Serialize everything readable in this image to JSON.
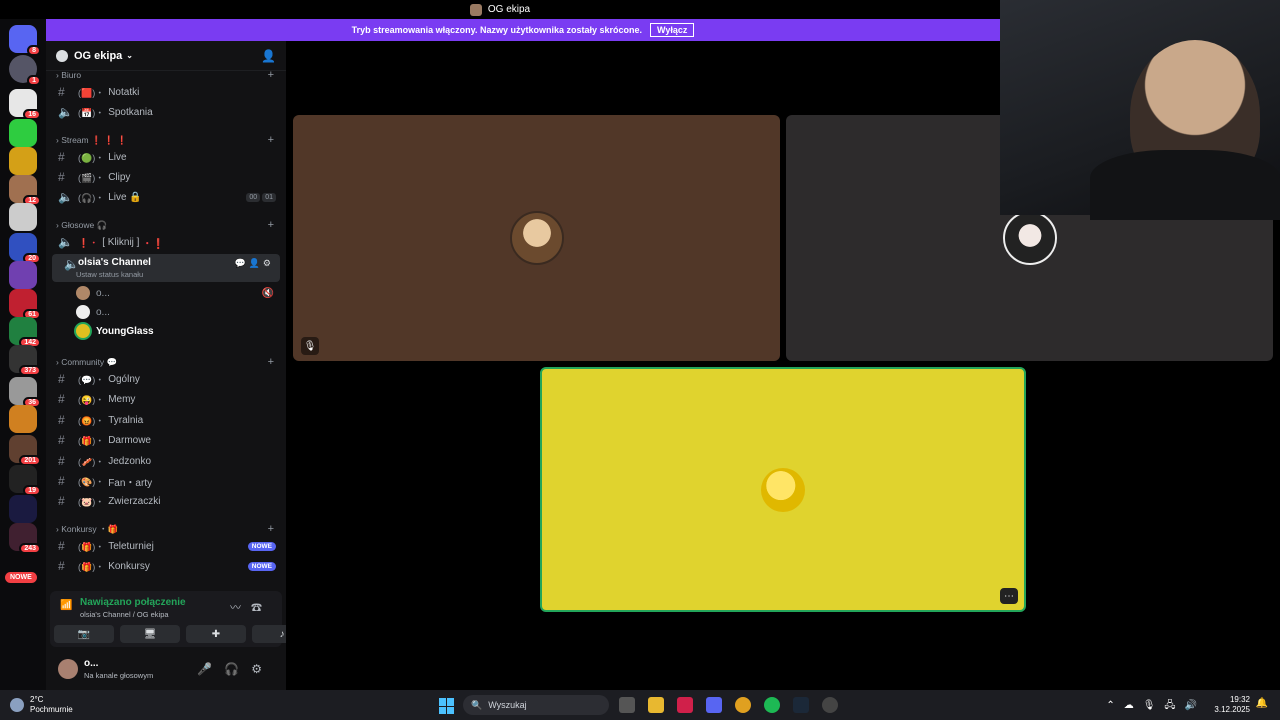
{
  "window": {
    "title": "OG ekipa"
  },
  "banner": {
    "text": "Tryb streamowania włączony. Nazwy użytkownika zostały skrócone.",
    "button": "Wyłącz"
  },
  "guilds": {
    "badges": [
      "8",
      "1",
      "16",
      "12",
      "41",
      "20",
      "61",
      "142",
      "373",
      "36",
      "201",
      "19",
      "243"
    ],
    "new_label": "NOWE"
  },
  "server": {
    "name": "OG ekipa"
  },
  "categories": {
    "biuro": "Biuro",
    "stream": "Stream",
    "stream_marks": "❗ ❗ ❗",
    "glosowe": "Głosowe",
    "community": "Community",
    "konkursy": "Konkursy"
  },
  "channels": {
    "notatki": "Notatki",
    "spotkania": "Spotkania",
    "live": "Live",
    "clipy": "Clipy",
    "live_voice": "Live",
    "live_voice_count_a": "00",
    "live_voice_count_b": "01",
    "kliknij": "[ Kliknij ]",
    "active": "olsia's Channel",
    "active_sub": "Ustaw status kanału",
    "ogolny": "Ogólny",
    "memy": "Memy",
    "tyralnia": "Tyralnia",
    "darmowe": "Darmowe",
    "jedzonko": "Jedzonko",
    "fan_arty": "Fan・arty",
    "zwierzaczki": "Zwierzaczki",
    "teleturniej": "Teleturniej",
    "konkursy": "Konkursy",
    "new_pill": "NOWE"
  },
  "voice_users": [
    "o...",
    "o...",
    "YoungGlass"
  ],
  "voice_panel": {
    "status": "Nawiązano połączenie",
    "location": "olsia's Channel / OG ekipa"
  },
  "user": {
    "name": "o...",
    "status": "Na kanale głosowym"
  },
  "taskbar": {
    "temp": "2°C",
    "weather": "Pochmurnie",
    "search": "Wyszukaj",
    "time": "19:32",
    "date": "3.12.2025"
  },
  "colors": {
    "banner": "#7a3cf2",
    "tile1": "#513728",
    "tile2": "#2d2b2c",
    "tile3": "#e0d32e",
    "speaking": "#23a55a"
  }
}
